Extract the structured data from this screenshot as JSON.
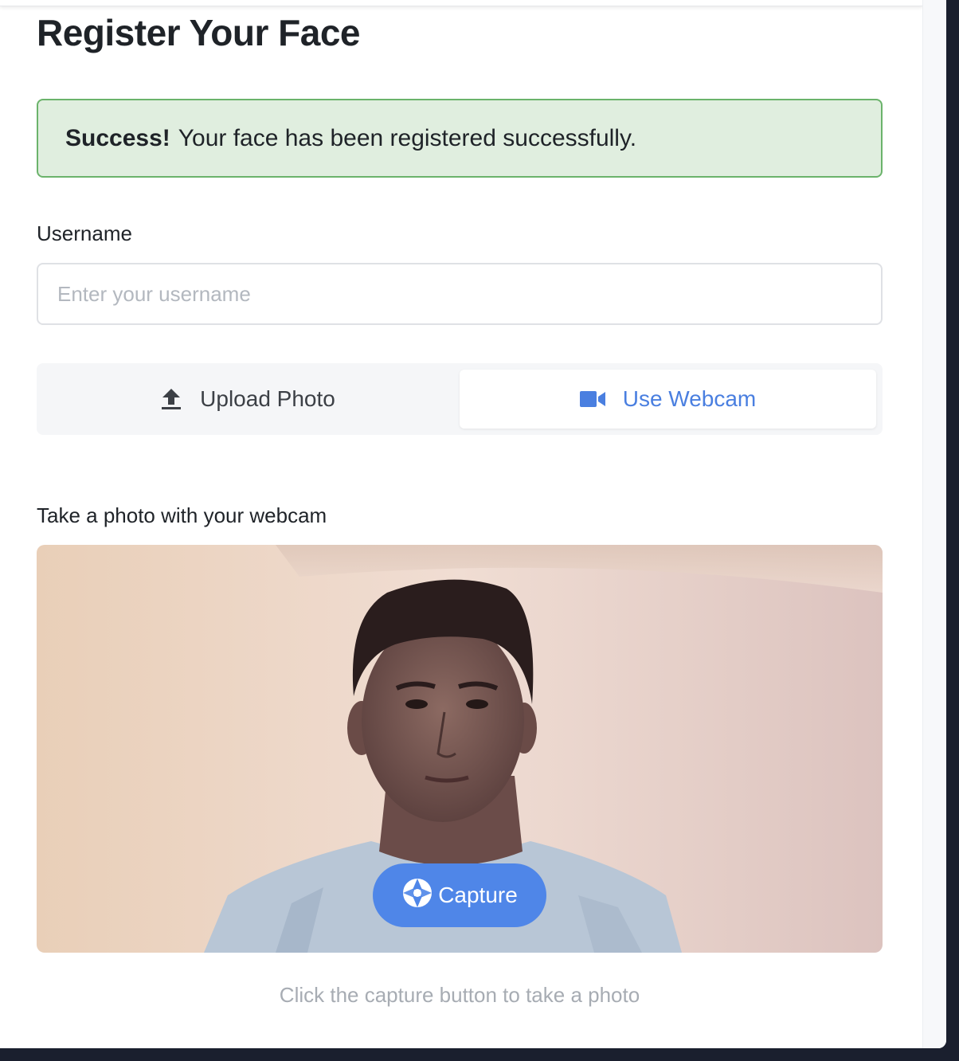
{
  "page": {
    "title": "Register Your Face"
  },
  "alert": {
    "strong": "Success!",
    "message": "Your face has been registered successfully."
  },
  "username": {
    "label": "Username",
    "placeholder": "Enter your username",
    "value": ""
  },
  "tabs": [
    {
      "label": "Upload Photo",
      "icon": "upload-icon",
      "active": false
    },
    {
      "label": "Use Webcam",
      "icon": "video-camera-icon",
      "active": true
    }
  ],
  "webcam": {
    "label": "Take a photo with your webcam",
    "capture_label": "Capture",
    "capture_icon": "camera-aperture-icon",
    "hint": "Click the capture button to take a photo"
  },
  "colors": {
    "accent": "#4f86e8",
    "success_bg": "#e0eedf",
    "success_border": "#6bb36b"
  }
}
